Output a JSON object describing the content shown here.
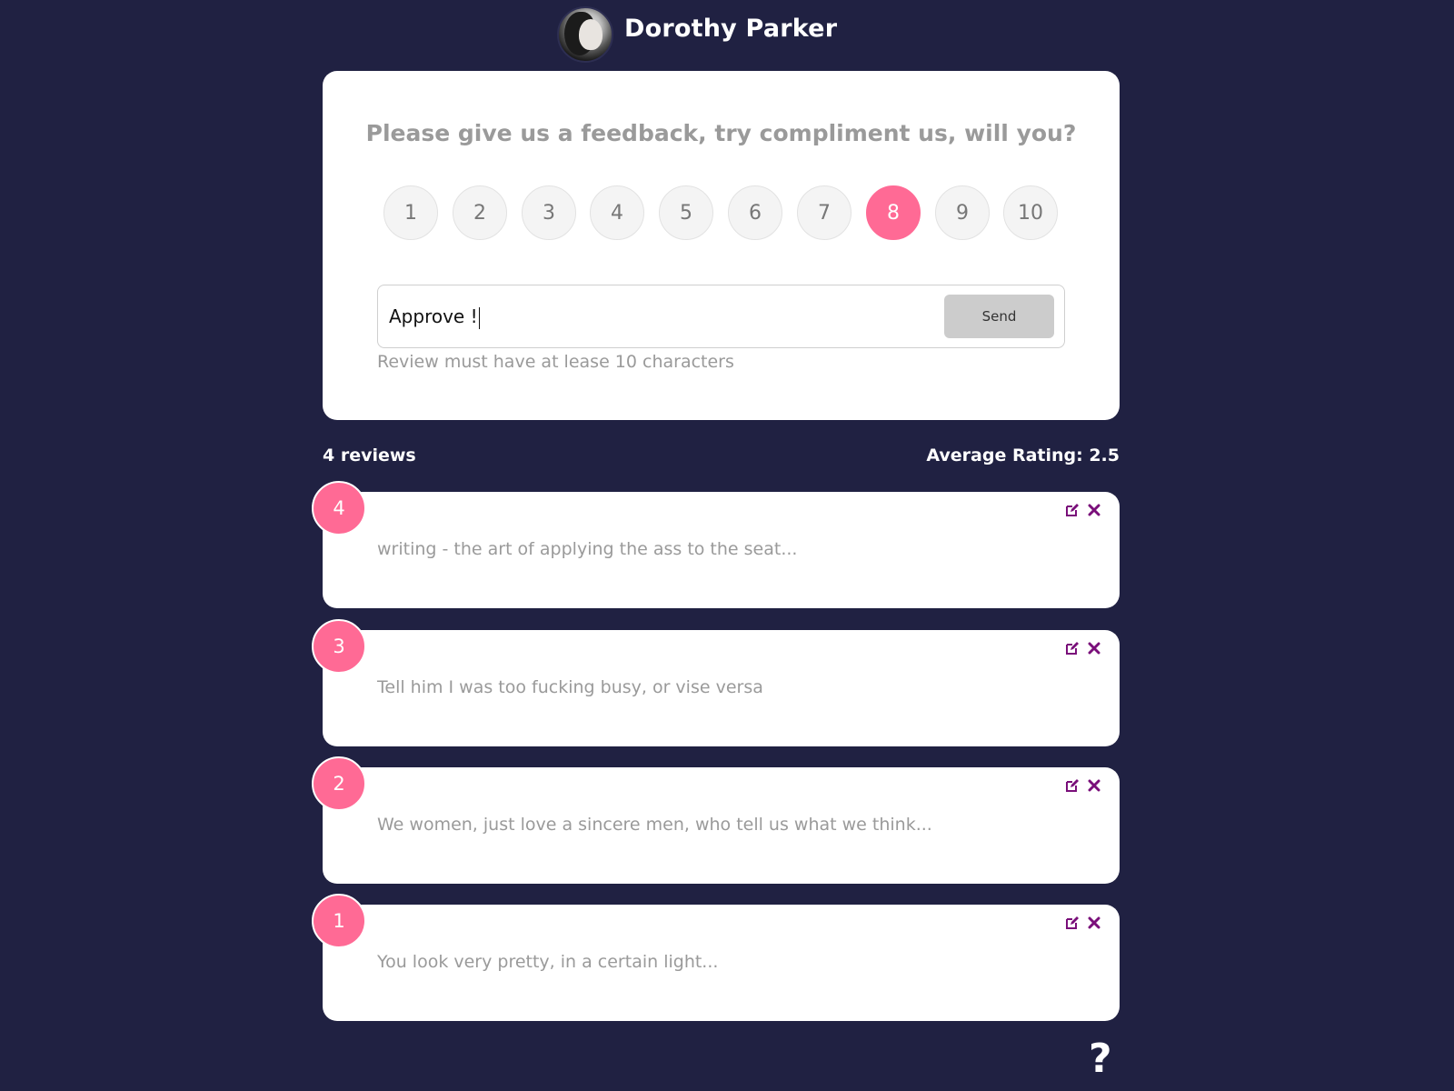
{
  "header": {
    "name": "Dorothy Parker"
  },
  "feedback": {
    "title": "Please give us a feedback, try compliment us, will you?",
    "rating_options": [
      "1",
      "2",
      "3",
      "4",
      "5",
      "6",
      "7",
      "8",
      "9",
      "10"
    ],
    "selected_rating": "8",
    "input_value": "Approve !",
    "send_label": "Send",
    "hint": "Review must have at lease 10 characters"
  },
  "stats": {
    "count_label": "4 reviews",
    "average_label": "Average Rating: 2.5"
  },
  "reviews": [
    {
      "rating": "4",
      "text": "writing - the art of applying the ass to the seat..."
    },
    {
      "rating": "3",
      "text": "Tell him I was too fucking busy, or vise versa"
    },
    {
      "rating": "2",
      "text": "We women, just love a sincere men, who tell us what we think..."
    },
    {
      "rating": "1",
      "text": "You look very pretty, in a certain light..."
    }
  ],
  "help": {
    "label": "?"
  },
  "colors": {
    "background": "#202142",
    "accent": "#ff6a95",
    "icon": "#7a0f7a"
  },
  "icons": {
    "edit": "edit-icon",
    "delete": "close-icon"
  }
}
